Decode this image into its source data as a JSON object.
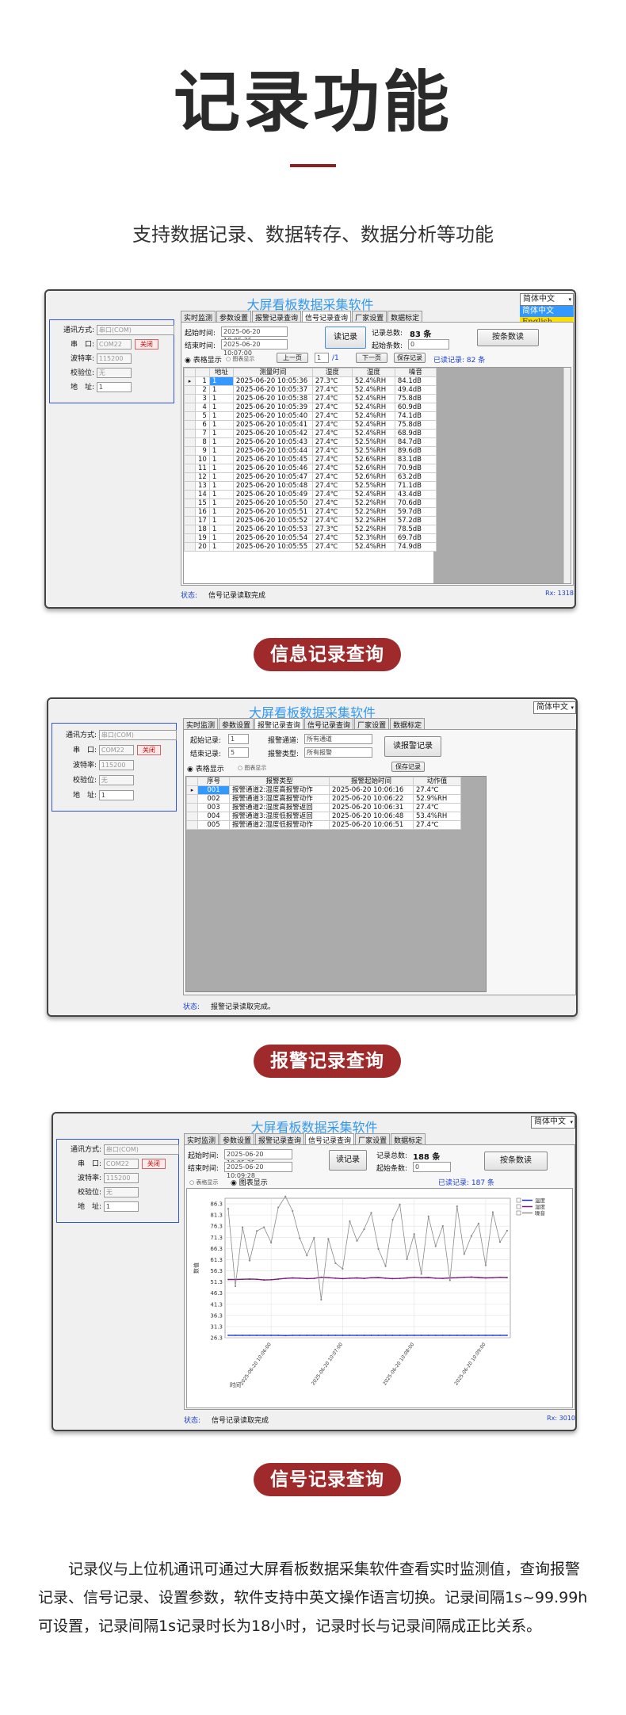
{
  "header": {
    "title": "记录功能",
    "subtitle": "支持数据记录、数据转存、数据分析等功能"
  },
  "common": {
    "app_title": "大屏看板数据采集软件",
    "comm_mode_label": "通讯方式:",
    "comm_mode_value": "串口(COM)",
    "port_label": "串　口:",
    "port_value": "COM22",
    "close_label": "关闭",
    "baud_label": "波特率:",
    "baud_value": "115200",
    "parity_label": "校验位:",
    "parity_value": "无",
    "addr_label": "地　址:",
    "addr_value": "1",
    "tabs": [
      "实时监测",
      "参数设置",
      "报警记录查询",
      "信号记录查询",
      "厂家设置",
      "数据标定"
    ],
    "table_display": "表格显示",
    "chart_display": "图表显示",
    "start_time_label": "起始时间:",
    "end_time_label": "结束时间:",
    "read_records": "读记录",
    "total_label": "记录总数:",
    "start_no_label": "起始条数:",
    "read_by_count": "按条数读",
    "status_label": "状态:"
  },
  "shot1": {
    "lang_selected": "简体中文",
    "lang_options": [
      "简体中文",
      "English"
    ],
    "active_tab": 3,
    "start_time": "2025-06-20 10:05:35",
    "end_time": "2025-06-20 10:07:00",
    "total": "83 条",
    "start_no": "0",
    "prev_page": "上一页",
    "page_num": "1",
    "page_total": "/1",
    "next_page": "下一页",
    "save_records": "保存记录",
    "read_count": "已读记录: 82 条",
    "columns": [
      "地址",
      "测量时间",
      "湿度",
      "湿度",
      "噪音"
    ],
    "rows": [
      [
        "1",
        "1",
        "2025-06-20 10:05:36",
        "27.3℃",
        "52.4%RH",
        "84.1dB"
      ],
      [
        "2",
        "1",
        "2025-06-20 10:05:37",
        "27.4℃",
        "52.4%RH",
        "49.4dB"
      ],
      [
        "3",
        "1",
        "2025-06-20 10:05:38",
        "27.4℃",
        "52.4%RH",
        "75.8dB"
      ],
      [
        "4",
        "1",
        "2025-06-20 10:05:39",
        "27.4℃",
        "52.4%RH",
        "60.9dB"
      ],
      [
        "5",
        "1",
        "2025-06-20 10:05:40",
        "27.4℃",
        "52.4%RH",
        "74.1dB"
      ],
      [
        "6",
        "1",
        "2025-06-20 10:05:41",
        "27.4℃",
        "52.4%RH",
        "75.8dB"
      ],
      [
        "7",
        "1",
        "2025-06-20 10:05:42",
        "27.4℃",
        "52.4%RH",
        "68.9dB"
      ],
      [
        "8",
        "1",
        "2025-06-20 10:05:43",
        "27.4℃",
        "52.5%RH",
        "84.7dB"
      ],
      [
        "9",
        "1",
        "2025-06-20 10:05:44",
        "27.4℃",
        "52.5%RH",
        "89.6dB"
      ],
      [
        "10",
        "1",
        "2025-06-20 10:05:45",
        "27.4℃",
        "52.6%RH",
        "83.1dB"
      ],
      [
        "11",
        "1",
        "2025-06-20 10:05:46",
        "27.4℃",
        "52.6%RH",
        "70.9dB"
      ],
      [
        "12",
        "1",
        "2025-06-20 10:05:47",
        "27.4℃",
        "52.6%RH",
        "63.2dB"
      ],
      [
        "13",
        "1",
        "2025-06-20 10:05:48",
        "27.4℃",
        "52.5%RH",
        "71.1dB"
      ],
      [
        "14",
        "1",
        "2025-06-20 10:05:49",
        "27.4℃",
        "52.4%RH",
        "43.4dB"
      ],
      [
        "15",
        "1",
        "2025-06-20 10:05:50",
        "27.4℃",
        "52.2%RH",
        "70.6dB"
      ],
      [
        "16",
        "1",
        "2025-06-20 10:05:51",
        "27.4℃",
        "52.2%RH",
        "59.7dB"
      ],
      [
        "17",
        "1",
        "2025-06-20 10:05:52",
        "27.4℃",
        "52.2%RH",
        "57.2dB"
      ],
      [
        "18",
        "1",
        "2025-06-20 10:05:53",
        "27.3℃",
        "52.2%RH",
        "78.5dB"
      ],
      [
        "19",
        "1",
        "2025-06-20 10:05:54",
        "27.4℃",
        "52.3%RH",
        "69.7dB"
      ],
      [
        "20",
        "1",
        "2025-06-20 10:05:55",
        "27.4℃",
        "52.4%RH",
        "74.9dB"
      ]
    ],
    "status_text": "信号记录读取完成",
    "rx": "Rx: 1318",
    "caption": "信息记录查询"
  },
  "shot2": {
    "lang_selected": "简体中文",
    "active_tab": 2,
    "start_record_label": "起始记录:",
    "start_record_value": "1",
    "end_record_label": "结束记录:",
    "end_record_value": "5",
    "alarm_channel_label": "报警通道:",
    "alarm_channel_value": "所有通道",
    "alarm_type_label": "报警类型:",
    "alarm_type_value": "所有报警",
    "read_alarm": "读报警记录",
    "save_records": "保存记录",
    "columns": [
      "序号",
      "报警类型",
      "报警起始时间",
      "动作值"
    ],
    "rows": [
      [
        "001",
        "报警通道2:湿度高报警动作",
        "2025-06-20 10:06:16",
        "27.4℃"
      ],
      [
        "002",
        "报警通道3:湿度高报警动作",
        "2025-06-20 10:06:22",
        "52.9%RH"
      ],
      [
        "003",
        "报警通道2:湿度高报警返回",
        "2025-06-20 10:06:31",
        "27.4℃"
      ],
      [
        "004",
        "报警通道3:湿度低报警返回",
        "2025-06-20 10:06:48",
        "53.4%RH"
      ],
      [
        "005",
        "报警通道2:湿度低报警动作",
        "2025-06-20 10:06:51",
        "27.4℃"
      ]
    ],
    "status_text": "报警记录读取完成。",
    "caption": "报警记录查询"
  },
  "shot3": {
    "lang_selected": "简体中文",
    "active_tab": 3,
    "start_time": "2025-06-20 10:05:35",
    "end_time": "2025-06-20 10:09:28",
    "total": "188 条",
    "start_no": "0",
    "read_count": "已读记录: 187 条",
    "status_text": "信号记录读取完成",
    "rx": "Rx: 3010",
    "caption": "信号记录查询"
  },
  "chart_data": {
    "type": "line",
    "ylabel": "数值",
    "xlabel": "时间",
    "yticks": [
      "86.3",
      "81.3",
      "76.3",
      "71.3",
      "66.3",
      "61.3",
      "56.3",
      "51.3",
      "46.3",
      "41.3",
      "36.3",
      "31.3",
      "26.3"
    ],
    "xticks": [
      "2025-06-20 10:06:00",
      "2025-06-20 10:07:00",
      "2025-06-20 10:08:00",
      "2025-06-20 10:09:00"
    ],
    "ylim": [
      26.3,
      88.8
    ],
    "grid": true,
    "legend_position": "top-right",
    "series": [
      {
        "name": "温度",
        "color": "#1a2fdc",
        "values": [
          27.4,
          27.4,
          27.4,
          27.4,
          27.4,
          27.4,
          27.4,
          27.4,
          27.3,
          27.4,
          27.4,
          27.4,
          27.4,
          27.4,
          27.4,
          27.4,
          27.4,
          27.4,
          27.4,
          27.4,
          27.4,
          27.4,
          27.4,
          27.4,
          27.4,
          27.4,
          27.4,
          27.4,
          27.4,
          27.4,
          27.4,
          27.4,
          27.4,
          27.4,
          27.4,
          27.4,
          27.4,
          27.4,
          27.4,
          27.4
        ]
      },
      {
        "name": "湿度",
        "color": "#7a1a7a",
        "values": [
          52.4,
          52.4,
          52.5,
          52.6,
          52.5,
          52.2,
          52.3,
          52.6,
          52.9,
          53.1,
          53.0,
          52.8,
          52.9,
          53.4,
          53.2,
          53.0,
          52.8,
          53.0,
          53.1,
          52.9,
          53.2,
          53.3,
          53.0,
          52.8,
          52.9,
          53.1,
          53.4,
          53.2,
          53.3,
          53.0,
          52.9,
          53.1,
          53.2,
          53.4,
          53.5,
          53.3,
          53.1,
          53.2,
          53.4,
          53.3
        ]
      },
      {
        "name": "噪音",
        "color": "#8a8a8a",
        "values": [
          84.1,
          49.4,
          75.8,
          60.9,
          74.1,
          75.8,
          68.9,
          84.7,
          89.6,
          83.1,
          70.9,
          63.2,
          71.1,
          43.4,
          70.6,
          59.7,
          57.2,
          78.5,
          69.7,
          74.9,
          82.3,
          66.1,
          58.4,
          79.2,
          86.0,
          61.5,
          72.8,
          54.9,
          80.7,
          67.3,
          76.4,
          52.1,
          85.2,
          63.8,
          71.9,
          77.5,
          58.8,
          82.6,
          69.2,
          74.3
        ]
      }
    ]
  },
  "footer": {
    "text": "记录仪与上位机通讯可通过大屏看板数据采集软件查看实时监测值，查询报警记录、信号记录、设置参数，软件支持中英文操作语言切换。记录间隔1s~99.99h可设置，记录间隔1s记录时长为18小时，记录时长与记录间隔成正比关系。"
  }
}
